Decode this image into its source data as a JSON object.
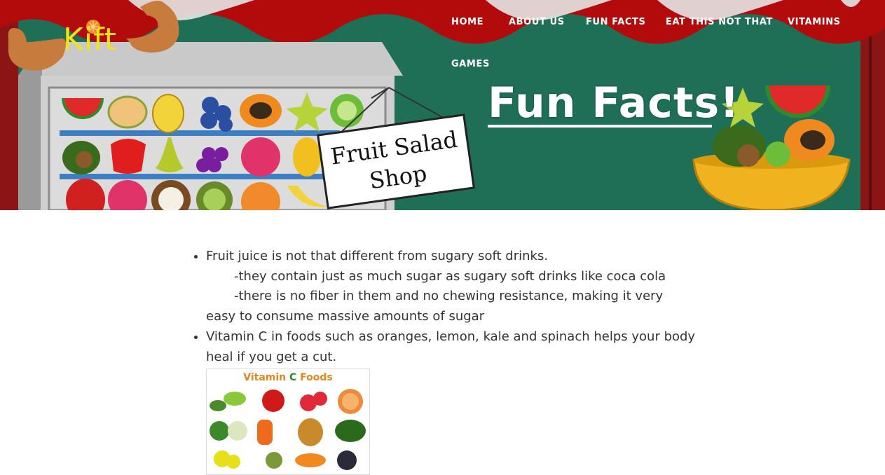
{
  "brand": {
    "logo_text": "Kift"
  },
  "nav": {
    "items": [
      {
        "label": "HOME"
      },
      {
        "label": "ABOUT US"
      },
      {
        "label": "FUN FACTS"
      },
      {
        "label": "EAT THIS NOT THAT"
      },
      {
        "label": "VITAMINS"
      },
      {
        "label": "GAMES"
      }
    ]
  },
  "hero": {
    "title": "Fun Facts!",
    "sign_line1": "Fruit Salad",
    "sign_line2": "Shop"
  },
  "facts": [
    {
      "text": "Fruit juice is not that different from sugary soft drinks.",
      "sub": [
        "-they contain just as much sugar as sugary soft drinks like coca cola",
        "-there is no fiber in them and no chewing resistance, making it very"
      ],
      "tail": "easy to consume massive amounts of sugar"
    },
    {
      "text": "Vitamin C in foods such as oranges, lemon, kale and spinach helps your body heal if you get a cut.",
      "image_title_part1": "Vitamin ",
      "image_title_part2": "C",
      "image_title_part3": " Foods"
    }
  ],
  "colors": {
    "curtain_red": "#b30b0b",
    "banner_green": "#1f6f57",
    "logo_yellow": "#f2e41a",
    "shelf_blue": "#3e7fc2"
  }
}
